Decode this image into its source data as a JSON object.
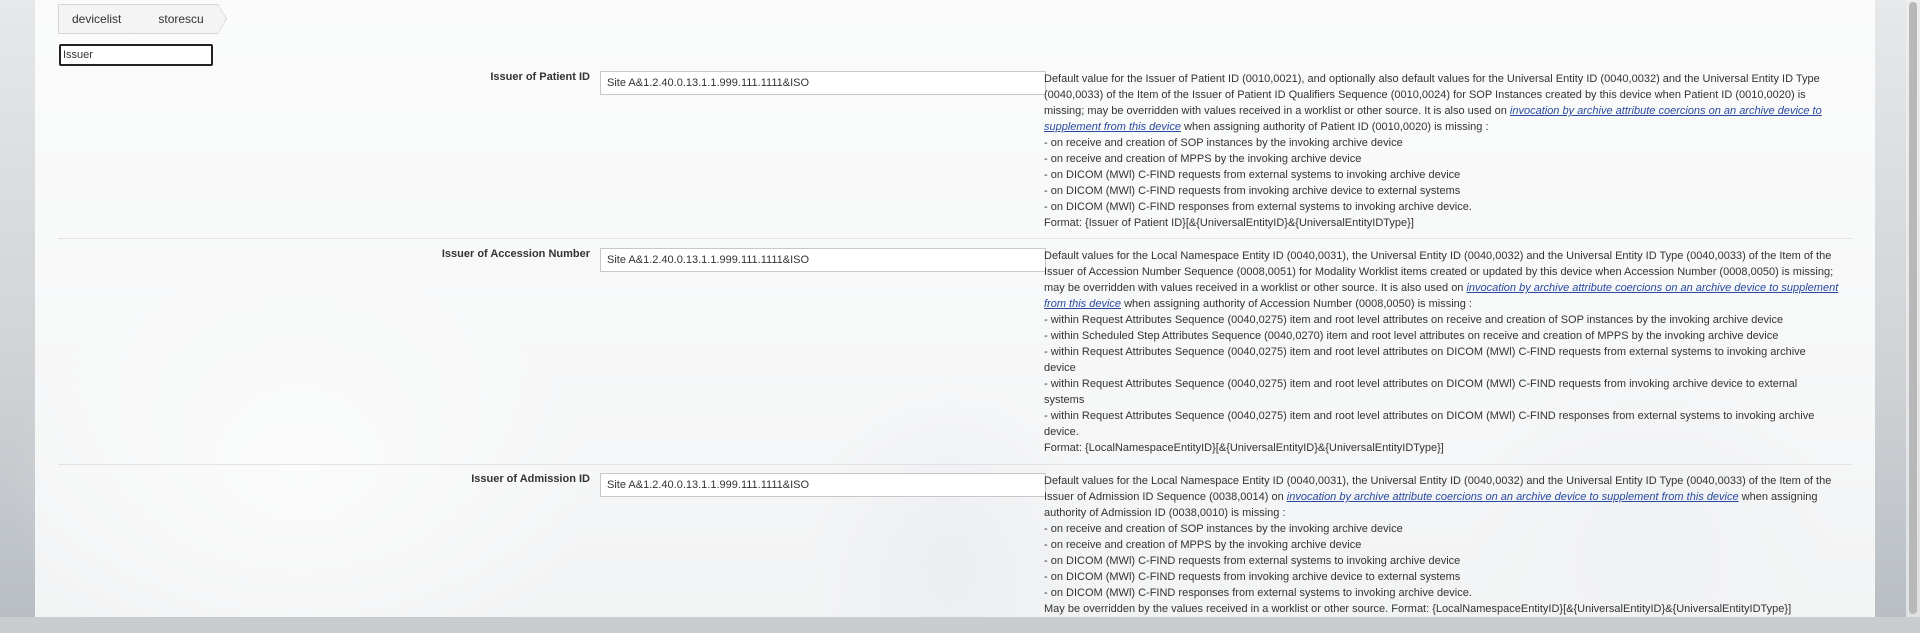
{
  "breadcrumb": {
    "items": [
      {
        "label": "devicelist"
      },
      {
        "label": "storescu"
      }
    ]
  },
  "filter": {
    "value": "Issuer"
  },
  "rows": [
    {
      "label": "Issuer of Patient ID",
      "value": "Site A&1.2.40.0.13.1.1.999.111.1111&ISO",
      "desc_pre": "Default value for the Issuer of Patient ID (0010,0021), and optionally also default values for the Universal Entity ID (0040,0032) and the Universal Entity ID Type (0040,0033) of the Item of the Issuer of Patient ID Qualifiers Sequence (0010,0024) for SOP Instances created by this device when Patient ID (0010,0020) is missing; may be overridden with values received in a worklist or other source. It is also used on ",
      "link": "invocation by archive attribute coercions on an archive device to supplement from this device",
      "desc_post": " when assigning authority of Patient ID (0010,0020) is missing :",
      "lines": [
        "- on receive and creation of SOP instances by the invoking archive device",
        "- on receive and creation of MPPS by the invoking archive device",
        "- on DICOM (MWl) C-FIND requests from external systems to invoking archive device",
        "- on DICOM (MWl) C-FIND requests from invoking archive device to external systems",
        "- on DICOM (MWl) C-FIND responses from external systems to invoking archive device.",
        "Format: {Issuer of Patient ID}[&{UniversalEntityID}&{UniversalEntityIDType}]"
      ]
    },
    {
      "label": "Issuer of Accession Number",
      "value": "Site A&1.2.40.0.13.1.1.999.111.1111&ISO",
      "desc_pre": "Default values for the Local Namespace Entity ID (0040,0031), the Universal Entity ID (0040,0032) and the Universal Entity ID Type (0040,0033) of the Item of the Issuer of Accession Number Sequence (0008,0051) for Modality Worklist items created or updated by this device when Accession Number (0008,0050) is missing; may be overridden with values received in a worklist or other source. It is also used on ",
      "link": "invocation by archive attribute coercions on an archive device to supplement from this device",
      "desc_post": " when assigning authority of Accession Number (0008,0050) is missing :",
      "lines": [
        "- within Request Attributes Sequence (0040,0275) item and root level attributes on receive and creation of SOP instances by the invoking archive device",
        "- within Scheduled Step Attributes Sequence (0040,0270) item and root level attributes on receive and creation of MPPS by the invoking archive device",
        "- within Request Attributes Sequence (0040,0275) item and root level attributes on DICOM (MWl) C-FIND requests from external systems to invoking archive device",
        "- within Request Attributes Sequence (0040,0275) item and root level attributes on DICOM (MWl) C-FIND requests from invoking archive device to external systems",
        "- within Request Attributes Sequence (0040,0275) item and root level attributes on DICOM (MWl) C-FIND responses from external systems to invoking archive device.",
        "Format: {LocalNamespaceEntityID}[&{UniversalEntityID}&{UniversalEntityIDType}]"
      ]
    },
    {
      "label": "Issuer of Admission ID",
      "value": "Site A&1.2.40.0.13.1.1.999.111.1111&ISO",
      "desc_pre": "Default values for the Local Namespace Entity ID (0040,0031), the Universal Entity ID (0040,0032) and the Universal Entity ID Type (0040,0033) of the Item of the Issuer of Admission ID Sequence (0038,0014) on ",
      "link": "invocation by archive attribute coercions on an archive device to supplement from this device",
      "desc_post": " when assigning authority of Admission ID (0038,0010) is missing :",
      "lines": [
        "- on receive and creation of SOP instances by the invoking archive device",
        "- on receive and creation of MPPS by the invoking archive device",
        "- on DICOM (MWl) C-FIND requests from external systems to invoking archive device",
        "- on DICOM (MWl) C-FIND requests from invoking archive device to external systems",
        "- on DICOM (MWl) C-FIND responses from external systems to invoking archive device.",
        "May be overridden by the values received in a worklist or other source. Format: {LocalNamespaceEntityID}[&{UniversalEntityID}&{UniversalEntityIDType}]"
      ]
    }
  ]
}
